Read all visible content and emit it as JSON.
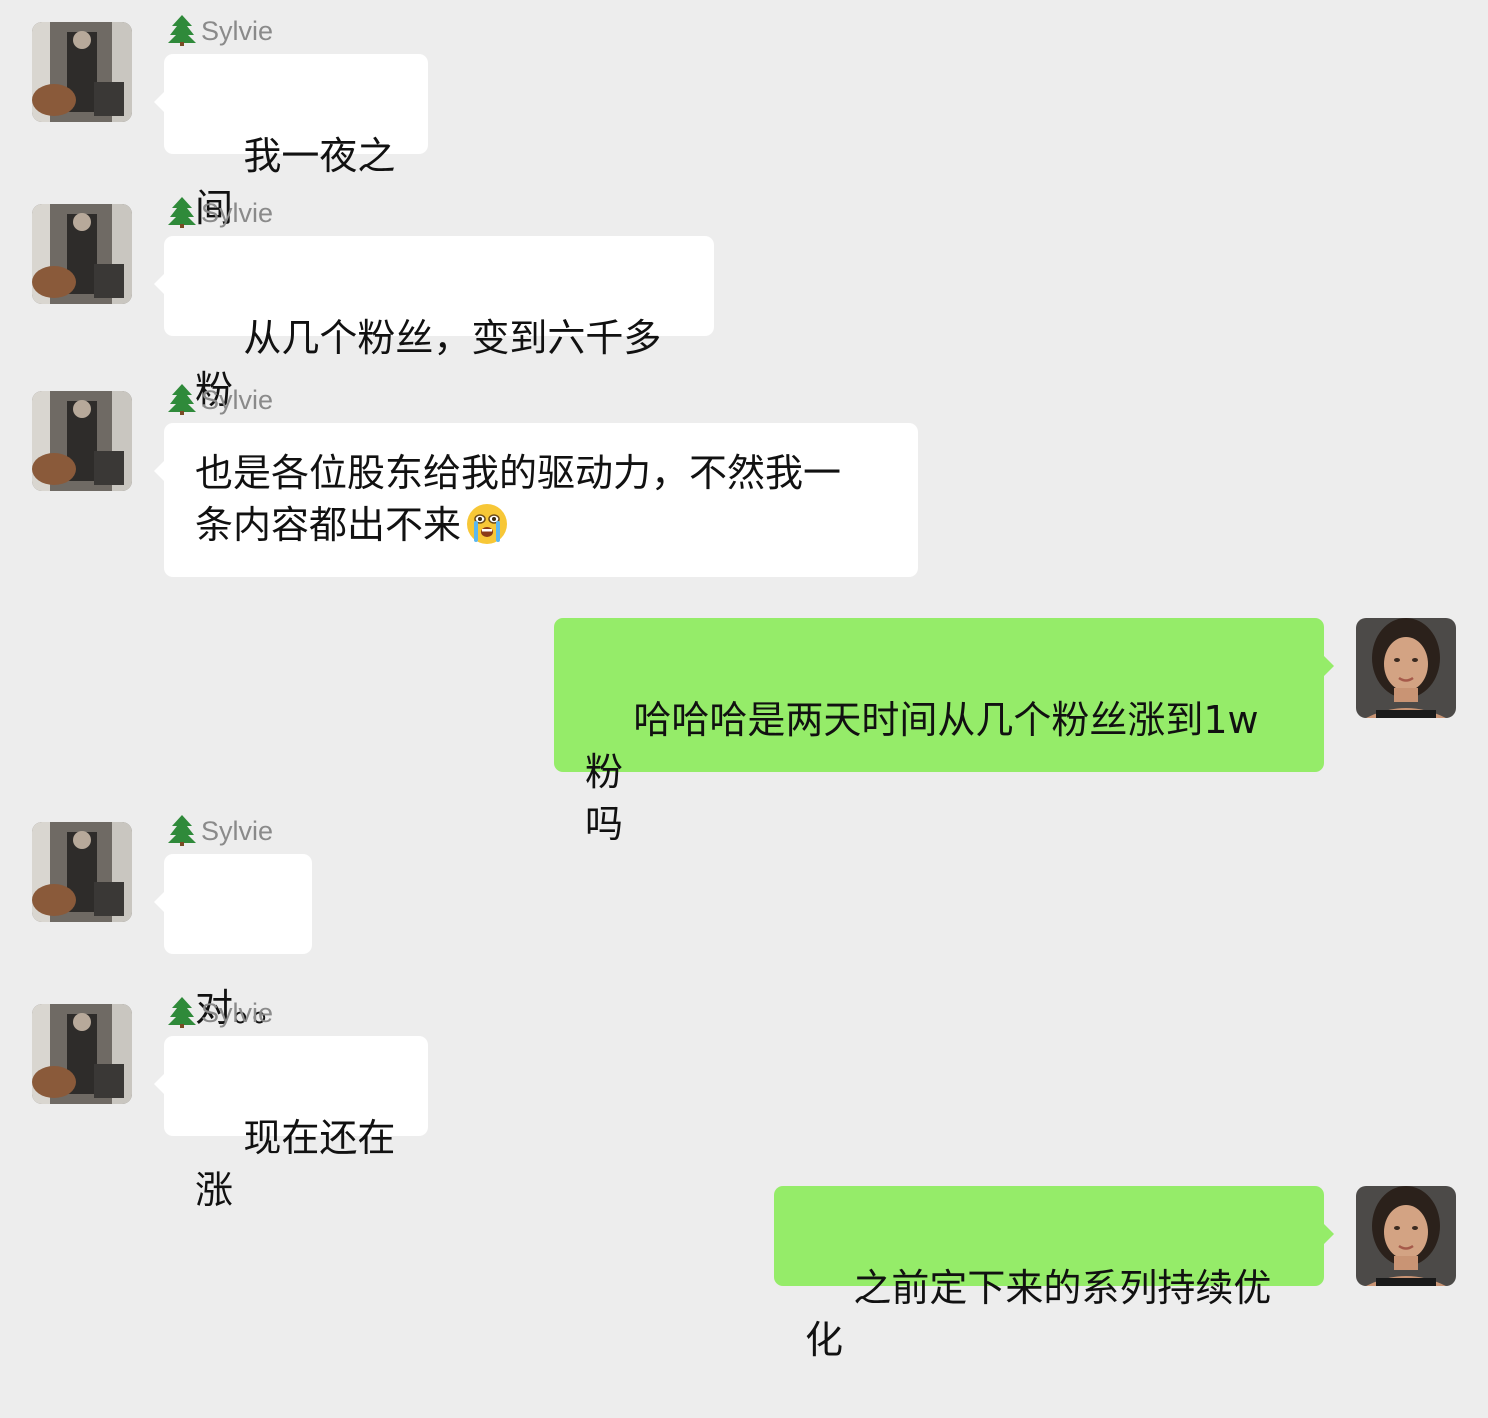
{
  "chat": {
    "messages": [
      {
        "side": "left",
        "sender": "Sylvie",
        "text": "我一夜之间"
      },
      {
        "side": "left",
        "sender": "Sylvie",
        "text": "从几个粉丝，变到六千多粉"
      },
      {
        "side": "left",
        "sender": "Sylvie",
        "text": "也是各位股东给我的驱动力，不然我一\n条内容都出不来",
        "emoji": "crying-face-emoji"
      },
      {
        "side": "right",
        "text": "哈哈哈是两天时间从几个粉丝涨到1w粉\n吗"
      },
      {
        "side": "left",
        "sender": "Sylvie",
        "text": "对。。"
      },
      {
        "side": "left",
        "sender": "Sylvie",
        "text": "现在还在涨"
      },
      {
        "side": "right",
        "text": "之前定下来的系列持续优化"
      }
    ]
  },
  "icons": {
    "sender_prefix": "christmas-tree-icon"
  },
  "colors": {
    "background": "#ededed",
    "incoming_bubble": "#ffffff",
    "outgoing_bubble": "#95ec69",
    "sender_name": "#8a8a8a"
  }
}
